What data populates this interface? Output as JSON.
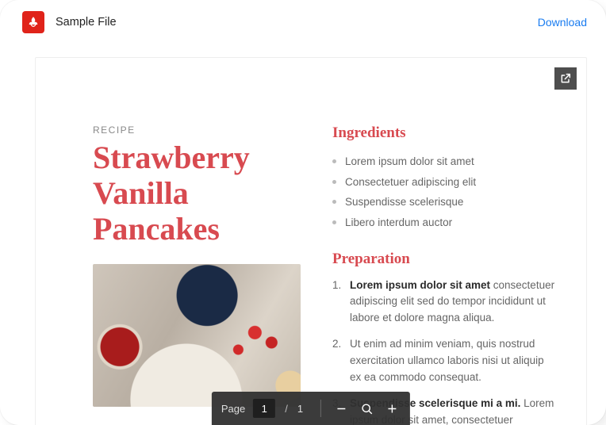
{
  "header": {
    "file_name": "Sample File",
    "download_label": "Download"
  },
  "viewer": {
    "open_external_tooltip": "Open in new tab"
  },
  "recipe": {
    "eyebrow": "RECIPE",
    "title": "Strawberry Vanilla Pancakes",
    "ingredients_heading": "Ingredients",
    "ingredients": [
      "Lorem ipsum dolor sit amet",
      "Consectetuer adipiscing elit",
      "Suspendisse scelerisque",
      "Libero interdum auctor"
    ],
    "preparation_heading": "Preparation",
    "steps": [
      {
        "lead": "Lorem ipsum dolor sit amet",
        "rest": " consectetuer adipiscing elit sed do tempor incididunt ut labore et dolore magna aliqua."
      },
      {
        "lead": "",
        "rest": "Ut enim ad minim veniam, quis nostrud exercitation ullamco laboris nisi ut aliquip ex ea commodo consequat."
      },
      {
        "lead": "Suspendisse scelerisque mi a mi.",
        "rest": " Lorem ipsum dolor sit amet, consectetuer"
      }
    ]
  },
  "toolbar": {
    "page_label": "Page",
    "current_page": "1",
    "page_separator": "/",
    "total_pages": "1"
  }
}
